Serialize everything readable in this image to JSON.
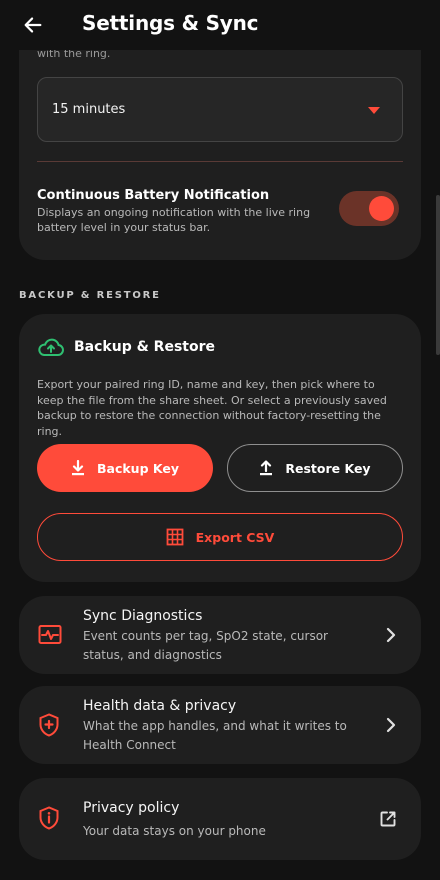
{
  "header": {
    "title": "Settings & Sync",
    "back_icon": "arrow-left-icon"
  },
  "sync_card": {
    "cut_text": "with the ring.",
    "interval_value": "15 minutes",
    "battery_title": "Continuous Battery Notification",
    "battery_desc": "Displays an ongoing notification with the live ring battery level in your status bar.",
    "battery_toggle_on": true
  },
  "backup_section": {
    "label": "BACKUP & RESTORE",
    "card_title": "Backup & Restore",
    "description": "Export your paired ring ID, name and key, then pick where to keep the file from the share sheet. Or select a previously saved backup to restore the connection without factory-resetting the ring.",
    "backup_label": "Backup Key",
    "restore_label": "Restore Key",
    "export_label": "Export CSV"
  },
  "rows": [
    {
      "title": "Sync Diagnostics",
      "desc": "Event counts per tag, SpO2 state, cursor status, and diagnostics",
      "icon": "pulse-icon"
    },
    {
      "title": "Health data & privacy",
      "desc": "What the app handles, and what it writes to Health Connect",
      "icon": "shield-plus-icon"
    },
    {
      "title": "Privacy policy",
      "desc": "Your data stays on your phone",
      "icon": "shield-info-icon"
    }
  ],
  "colors": {
    "accent": "#ff4b3a",
    "cloud_icon": "#2fbf71",
    "background": "#121212",
    "card": "#1f1f1f"
  }
}
